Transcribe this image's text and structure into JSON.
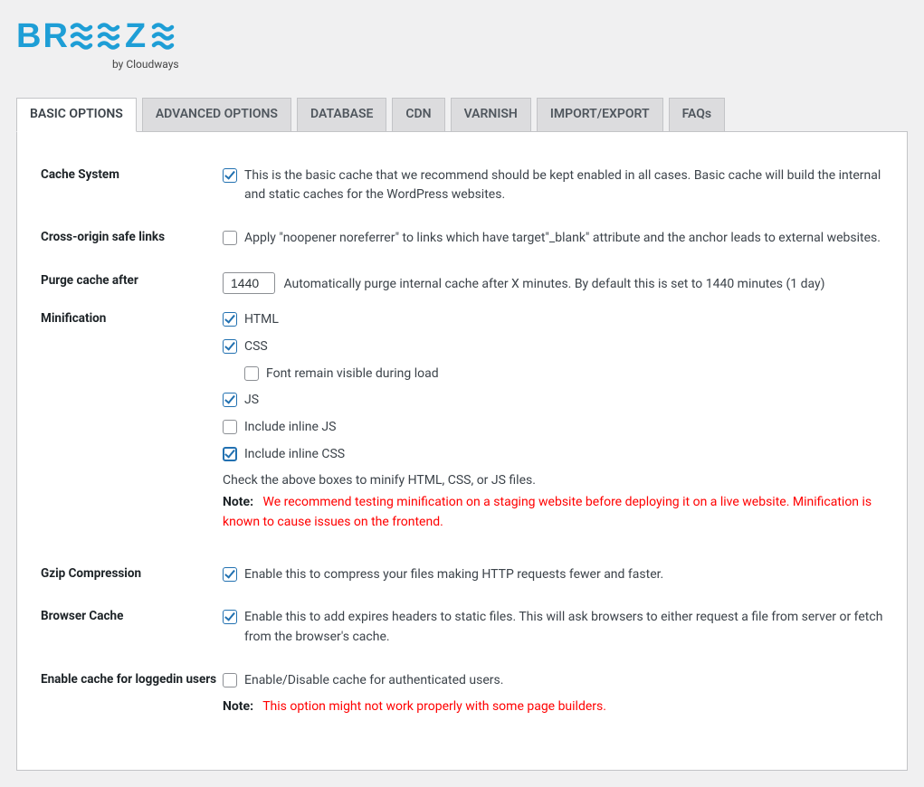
{
  "logo": {
    "text": "BREEZE",
    "byline": "by Cloudways",
    "color": "#1e9ed6"
  },
  "tabs": [
    {
      "label": "BASIC OPTIONS",
      "active": true
    },
    {
      "label": "ADVANCED OPTIONS",
      "active": false
    },
    {
      "label": "DATABASE",
      "active": false
    },
    {
      "label": "CDN",
      "active": false
    },
    {
      "label": "VARNISH",
      "active": false
    },
    {
      "label": "IMPORT/EXPORT",
      "active": false
    },
    {
      "label": "FAQs",
      "active": false
    }
  ],
  "fields": {
    "cache_system": {
      "label": "Cache System",
      "desc": "This is the basic cache that we recommend should be kept enabled in all cases. Basic cache will build the internal and static caches for the WordPress websites.",
      "checked": true
    },
    "cross_origin": {
      "label": "Cross-origin safe links",
      "desc": "Apply \"noopener noreferrer\" to links which have target\"_blank\" attribute and the anchor leads to external websites.",
      "checked": false
    },
    "purge_after": {
      "label": "Purge cache after",
      "value": "1440",
      "desc": "Automatically purge internal cache after X minutes. By default this is set to 1440 minutes (1 day)"
    },
    "minification": {
      "label": "Minification",
      "options": {
        "html": {
          "label": "HTML",
          "checked": true
        },
        "css": {
          "label": "CSS",
          "checked": true
        },
        "font_visible": {
          "label": "Font remain visible during load",
          "checked": false
        },
        "js": {
          "label": "JS",
          "checked": true
        },
        "inline_js": {
          "label": "Include inline JS",
          "checked": false
        },
        "inline_css": {
          "label": "Include inline CSS",
          "checked": true
        }
      },
      "help": "Check the above boxes to minify HTML, CSS, or JS files.",
      "note_label": "Note:",
      "note": "We recommend testing minification on a staging website before deploying it on a live website. Minification is known to cause issues on the frontend."
    },
    "gzip": {
      "label": "Gzip Compression",
      "desc": "Enable this to compress your files making HTTP requests fewer and faster.",
      "checked": true
    },
    "browser_cache": {
      "label": "Browser Cache",
      "desc": "Enable this to add expires headers to static files. This will ask browsers to either request a file from server or fetch from the browser's cache.",
      "checked": true
    },
    "loggedin_cache": {
      "label": "Enable cache for loggedin users",
      "desc": "Enable/Disable cache for authenticated users.",
      "checked": false,
      "note_label": "Note:",
      "note": "This option might not work properly with some page builders."
    }
  }
}
